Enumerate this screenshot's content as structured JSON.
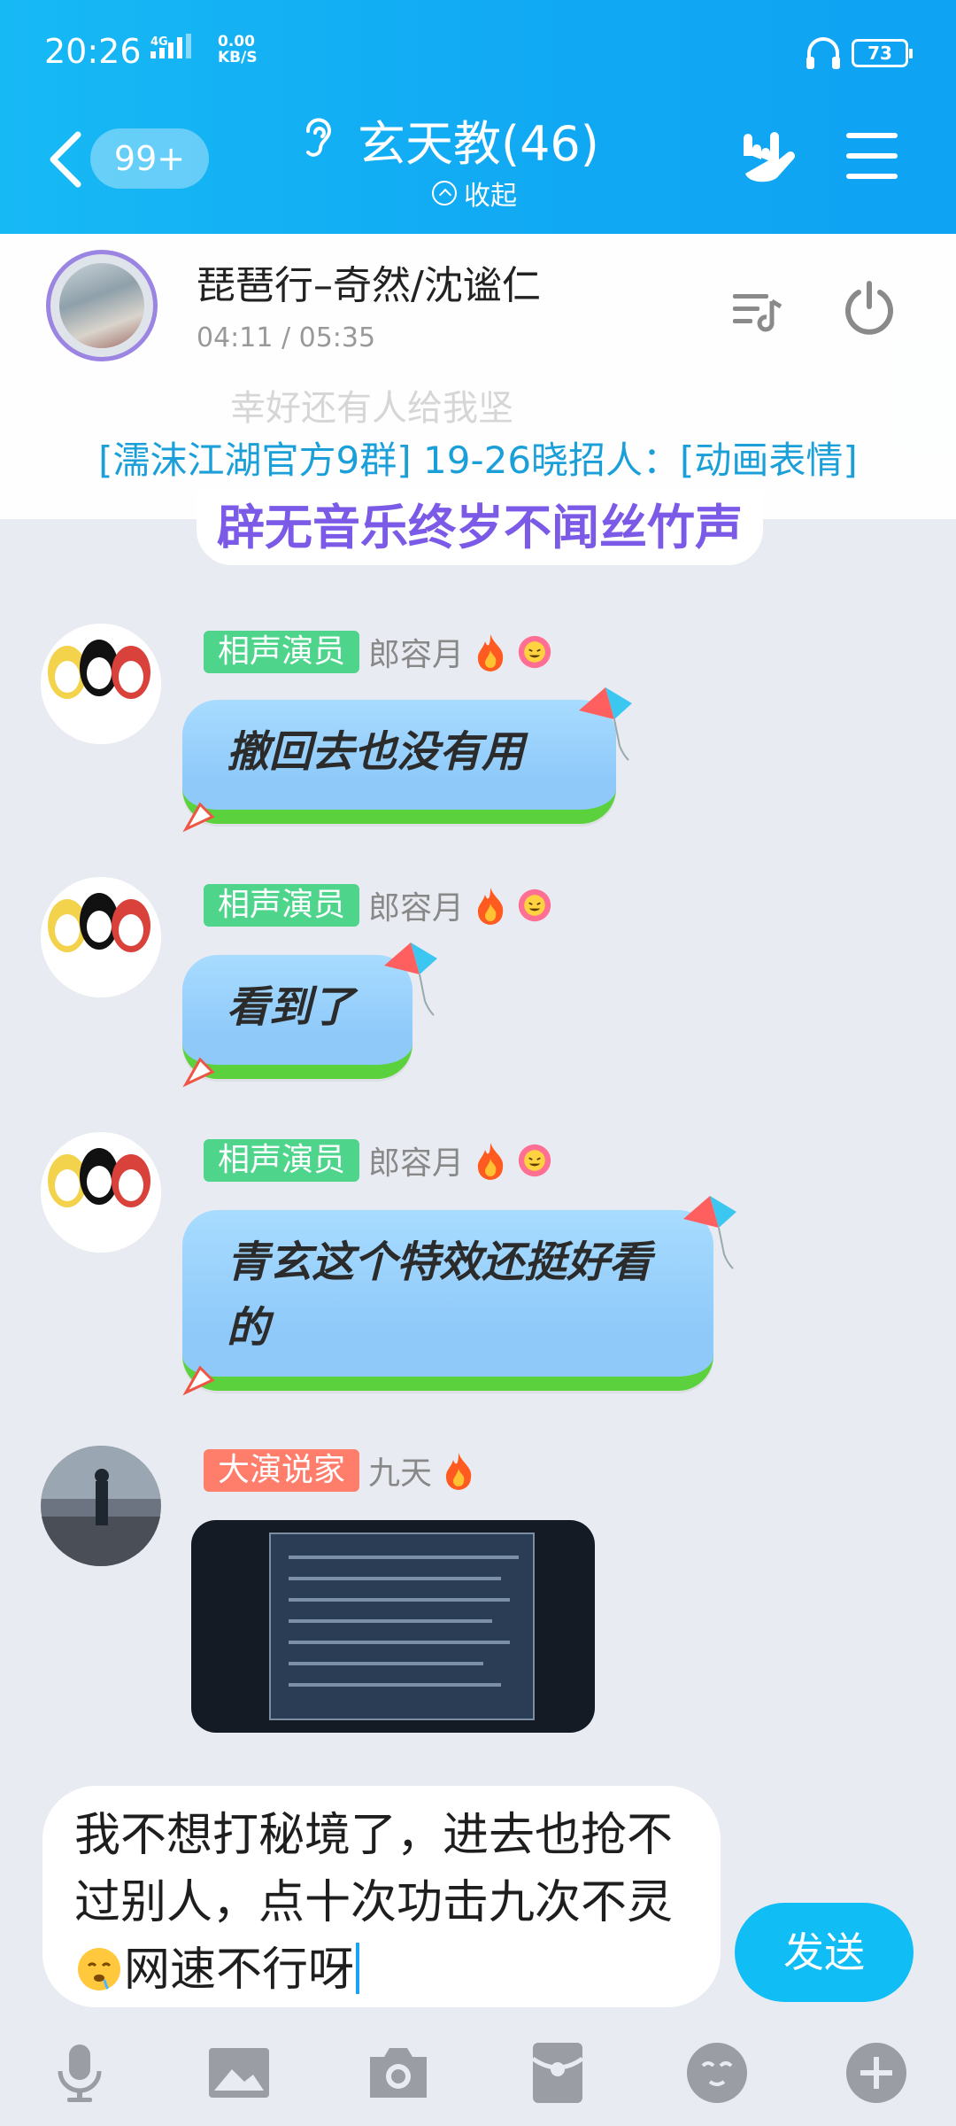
{
  "status_bar": {
    "time": "20:26",
    "network": "4G",
    "speed_value": "0.00",
    "speed_unit": "KB/S",
    "battery": "73"
  },
  "header": {
    "unread": "99+",
    "title": "玄天教(46)",
    "collapse": "收起"
  },
  "music": {
    "song": "琵琶行–奇然/沈谧仁",
    "progress": "04:11 / 05:35",
    "ghost_text": "幸好还有人给我坚",
    "notice": "[濡沫江湖官方9群] 19-26晓招人：[动画表情]",
    "lyric": "辟无音乐终岁不闻丝竹声"
  },
  "messages": [
    {
      "tag": "相声演员",
      "nick": "郎容月",
      "text": "撤回去也没有用"
    },
    {
      "tag": "相声演员",
      "nick": "郎容月",
      "text": "看到了"
    },
    {
      "tag": "相声演员",
      "nick": "郎容月",
      "text": "青玄这个特效还挺好看的"
    },
    {
      "tag": "大演说家",
      "nick": "九天",
      "text": ""
    }
  ],
  "composer": {
    "text_a": "我不想打秘境了，进去也抢不过别人，点十次功击九次不灵",
    "text_b": "网速不行呀",
    "send": "发送"
  },
  "colors": {
    "header": "#10a8f3",
    "bubble": "#8ec9fa",
    "bubble_grass": "#5bd23d",
    "tag_green": "#4fd48c",
    "tag_red": "#ff7d6b",
    "send": "#11bdf5"
  },
  "icons": [
    "back-icon",
    "ear-icon",
    "rock-hand-icon",
    "menu-icon",
    "playlist-icon",
    "power-icon",
    "fire-icon",
    "flower-badge-icon",
    "kite-icon",
    "mic-icon",
    "image-icon",
    "camera-icon",
    "red-packet-icon",
    "emoji-icon",
    "plus-icon"
  ]
}
